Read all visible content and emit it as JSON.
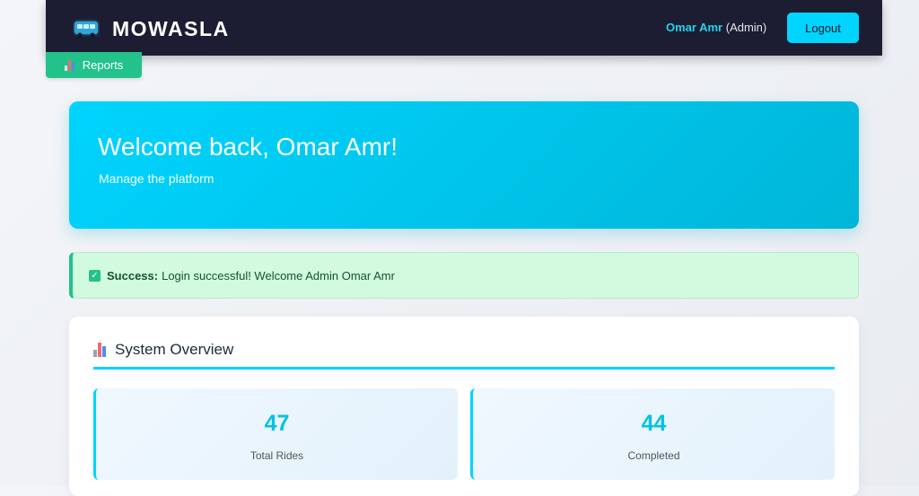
{
  "navbar": {
    "brand": "MOWASLA",
    "brand_icon": "bus-icon",
    "user_name": "Omar Amr",
    "user_role": "(Admin)",
    "logout_label": "Logout"
  },
  "tabs": {
    "reports_label": "Reports",
    "reports_icon": "bar-chart-icon"
  },
  "hero": {
    "title": "Welcome back, Omar Amr!",
    "subtitle": "Manage the platform"
  },
  "alert": {
    "label": "Success:",
    "message": "Login successful! Welcome Admin Omar Amr",
    "icon": "check-icon"
  },
  "overview": {
    "title": "System Overview",
    "icon": "bar-chart-icon",
    "stats": [
      {
        "value": "47",
        "label": "Total Rides"
      },
      {
        "value": "44",
        "label": "Completed"
      }
    ]
  },
  "colors": {
    "accent": "#00d4ff",
    "navbar_bg": "#1c1d33",
    "success": "#22c28a",
    "alert_bg": "#d1fadf"
  }
}
